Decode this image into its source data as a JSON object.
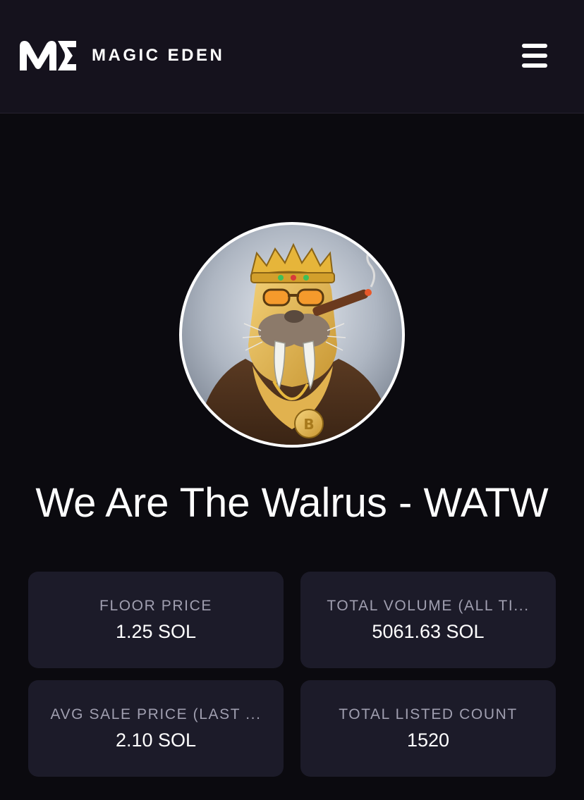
{
  "header": {
    "brand": "MAGIC EDEN",
    "logo_icon": "magic-eden-logo",
    "menu_icon": "hamburger-menu-icon"
  },
  "collection": {
    "title": "We Are The Walrus - WATW",
    "avatar_description": "walrus-with-crown-icon"
  },
  "stats": [
    {
      "label": "FLOOR PRICE",
      "value": "1.25 SOL"
    },
    {
      "label": "TOTAL VOLUME (ALL TI...",
      "value": "5061.63 SOL"
    },
    {
      "label": "AVG SALE PRICE (LAST ...",
      "value": "2.10 SOL"
    },
    {
      "label": "TOTAL LISTED COUNT",
      "value": "1520"
    }
  ],
  "colors": {
    "background": "#0b0a0f",
    "header": "#15121d",
    "card": "#1c1b29",
    "label": "#a09fb0",
    "text": "#ffffff"
  }
}
